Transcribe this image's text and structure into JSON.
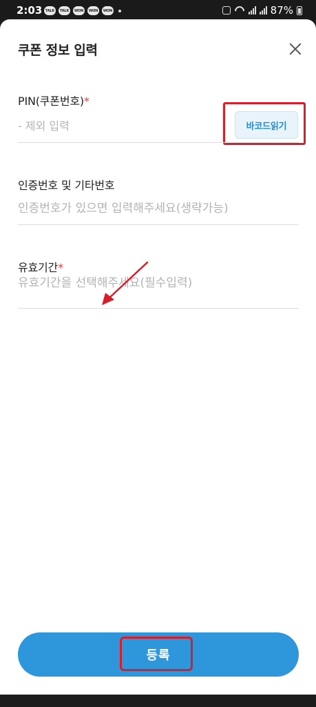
{
  "status_bar": {
    "time": "2:03",
    "notifications": [
      "TALK",
      "TALK",
      "WON",
      "WON",
      "WON"
    ],
    "battery_level": "87%"
  },
  "sheet": {
    "title": "쿠폰 정보 입력",
    "close_icon": "close-icon"
  },
  "fields": {
    "pin": {
      "label": "PIN(쿠폰번호)",
      "required_mark": "*",
      "placeholder": "- 제외 입력",
      "barcode_button": "바코드읽기"
    },
    "auth": {
      "label": "인증번호 및 기타번호",
      "placeholder": "인증번호가 있으면 입력해주세요(생략가능)"
    },
    "expiry": {
      "label": "유효기간",
      "required_mark": "*",
      "placeholder": "유효기간을 선택해주세요(필수입력)"
    }
  },
  "submit": {
    "label": "등록"
  },
  "colors": {
    "accent": "#2e97dc",
    "annotation": "#d91e2a",
    "required": "#e53935"
  }
}
